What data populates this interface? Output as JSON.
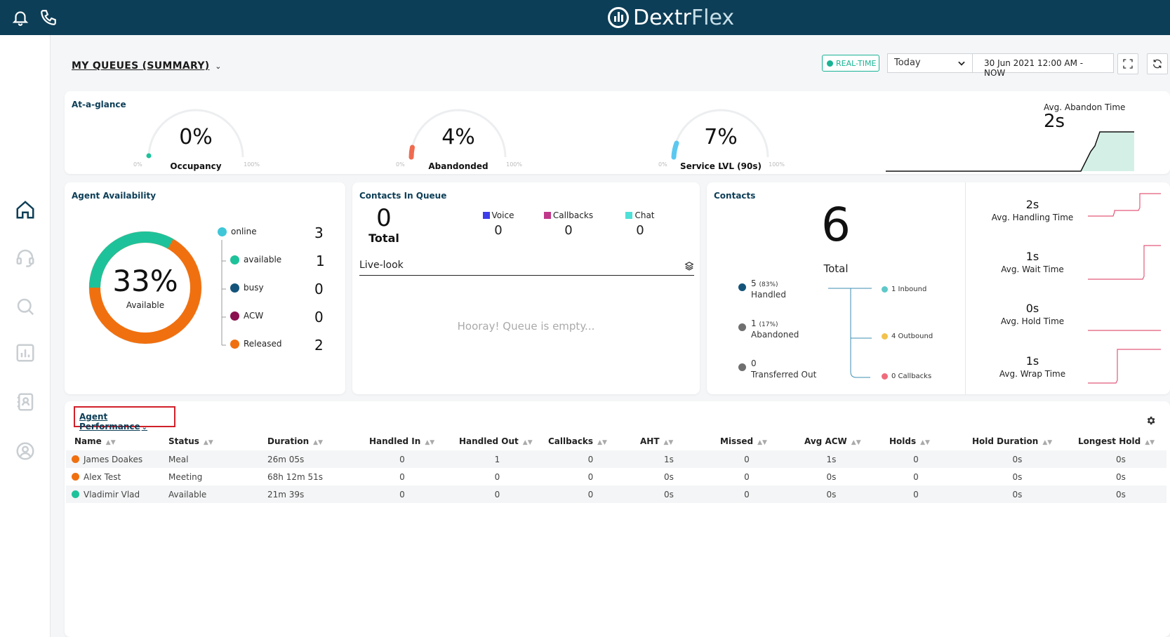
{
  "app": {
    "logo_main": "Dextr",
    "logo_accent": "Flex"
  },
  "header": {
    "title": "MY QUEUES (SUMMARY)",
    "realtime_label": "REAL-TIME",
    "period": "Today",
    "date_range": "30 Jun 2021 12:00 AM - NOW"
  },
  "glance": {
    "title": "At-a-glance",
    "occupancy": {
      "value": "0%",
      "label": "Occupancy",
      "min": "0%",
      "max": "100%",
      "fraction": 0.0
    },
    "abandoned": {
      "value": "4%",
      "label": "Abandonded",
      "min": "0%",
      "max": "100%",
      "fraction": 0.04
    },
    "service": {
      "value": "7%",
      "label": "Service LVL (90s)",
      "min": "0%",
      "max": "100%",
      "fraction": 0.07
    },
    "avg_abandon": {
      "label": "Avg. Abandon Time",
      "value": "2s"
    }
  },
  "availability": {
    "title": "Agent Availability",
    "percent": "33%",
    "percent_label": "Available",
    "items": [
      {
        "label": "online",
        "count": "3",
        "color": "#3fc7d8"
      },
      {
        "label": "available",
        "count": "1",
        "color": "#1ec29a"
      },
      {
        "label": "busy",
        "count": "0",
        "color": "#15547a"
      },
      {
        "label": "ACW",
        "count": "0",
        "color": "#8a1050"
      },
      {
        "label": "Released",
        "count": "2",
        "color": "#f0700f"
      }
    ]
  },
  "queue": {
    "title": "Contacts In Queue",
    "total": "0",
    "total_label": "Total",
    "channels": [
      {
        "label": "Voice",
        "count": "0",
        "color": "#3d3dea"
      },
      {
        "label": "Callbacks",
        "count": "0",
        "color": "#c0388a"
      },
      {
        "label": "Chat",
        "count": "0",
        "color": "#4fe0d8"
      }
    ],
    "livelook_label": "Live-look",
    "empty_text": "Hooray! Queue is empty..."
  },
  "contacts": {
    "title": "Contacts",
    "total": "6",
    "total_label": "Total",
    "stats": [
      {
        "count": "5",
        "pct": "(83%)",
        "label": "Handled",
        "color": "#15547a"
      },
      {
        "count": "1",
        "pct": "(17%)",
        "label": "Abandoned",
        "color": "#6f6f6f"
      },
      {
        "count": "0",
        "pct": "",
        "label": "Transferred Out",
        "color": "#6f6f6f"
      }
    ],
    "routes": [
      {
        "label": "1 Inbound",
        "color": "#5fc8c8"
      },
      {
        "label": "4 Outbound",
        "color": "#f2c24c"
      },
      {
        "label": "0 Callbacks",
        "color": "#ef6b7c"
      }
    ],
    "metrics": [
      {
        "value": "2s",
        "label": "Avg. Handling Time"
      },
      {
        "value": "1s",
        "label": "Avg. Wait Time"
      },
      {
        "value": "0s",
        "label": "Avg. Hold Time"
      },
      {
        "value": "1s",
        "label": "Avg. Wrap Time"
      }
    ]
  },
  "performance": {
    "title": "Agent Performance",
    "columns": [
      "Name",
      "Status",
      "Duration",
      "Handled In",
      "Handled Out",
      "Callbacks",
      "AHT",
      "Missed",
      "Avg ACW",
      "Holds",
      "Hold Duration",
      "Longest Hold"
    ],
    "rows": [
      {
        "name": "James Doakes",
        "dot": "#f0700f",
        "status": "Meal",
        "duration": "26m 05s",
        "handled_in": "0",
        "handled_out": "1",
        "callbacks": "0",
        "aht": "1s",
        "missed": "0",
        "avg_acw": "1s",
        "holds": "0",
        "hold_duration": "0s",
        "longest_hold": "0s"
      },
      {
        "name": "Alex Test",
        "dot": "#f0700f",
        "status": "Meeting",
        "duration": "68h 12m 51s",
        "handled_in": "0",
        "handled_out": "0",
        "callbacks": "0",
        "aht": "0s",
        "missed": "0",
        "avg_acw": "0s",
        "holds": "0",
        "hold_duration": "0s",
        "longest_hold": "0s"
      },
      {
        "name": "Vladimir Vlad",
        "dot": "#1ec29a",
        "status": "Available",
        "duration": "21m 39s",
        "handled_in": "0",
        "handled_out": "0",
        "callbacks": "0",
        "aht": "0s",
        "missed": "0",
        "avg_acw": "0s",
        "holds": "0",
        "hold_duration": "0s",
        "longest_hold": "0s"
      }
    ]
  },
  "icons": [
    "bell-icon",
    "phone-icon",
    "home-icon",
    "headset-icon",
    "search-icon",
    "reports-icon",
    "contacts-book-icon",
    "user-circle-icon",
    "expand-icon",
    "refresh-icon",
    "settings-gear-icon",
    "layers-icon"
  ]
}
